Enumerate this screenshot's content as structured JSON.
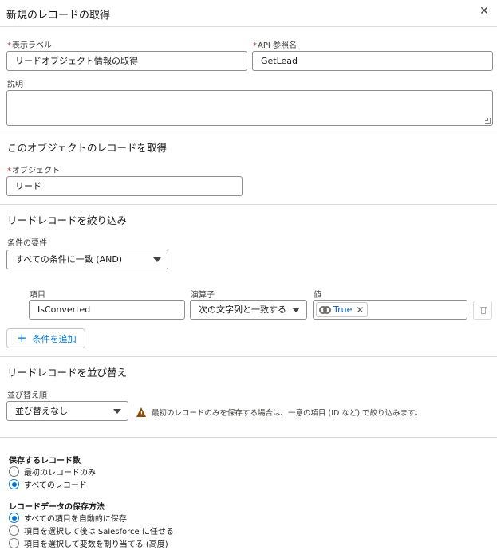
{
  "header": {
    "title": "新規のレコードの取得",
    "close_icon": "close-icon"
  },
  "basic": {
    "label_field": {
      "label": "表示ラベル",
      "value": "リードオブジェクト情報の取得"
    },
    "api_field": {
      "label": "API 参照名",
      "value": "GetLead"
    },
    "description": {
      "label": "説明",
      "value": ""
    }
  },
  "object_section": {
    "title": "このオブジェクトのレコードを取得",
    "object_field": {
      "label": "オブジェクト",
      "value": "リード"
    }
  },
  "filter_section": {
    "title": "リードレコードを絞り込み",
    "requirement_label": "条件の要件",
    "requirement_value": "すべての条件に一致 (AND)",
    "condition": {
      "field_label": "項目",
      "field_value": "IsConverted",
      "operator_label": "演算子",
      "operator_value": "次の文字列と一致する",
      "value_label": "値",
      "value_pill": "True",
      "value_pill_icon": "toggle-icon",
      "delete_icon": "trash-icon"
    },
    "add_condition_label": "条件を追加",
    "add_icon": "plus-icon"
  },
  "sort_section": {
    "title": "リードレコードを並び替え",
    "sort_label": "並び替え順",
    "sort_value": "並び替えなし",
    "warning_icon": "warning-icon",
    "warning_text": "最初のレコードのみを保存する場合は、一意の項目 (ID など) で絞り込みます。"
  },
  "store": {
    "count_title": "保存するレコード数",
    "count_options": [
      {
        "label": "最初のレコードのみ",
        "selected": false
      },
      {
        "label": "すべてのレコード",
        "selected": true
      }
    ],
    "method_title": "レコードデータの保存方法",
    "method_options": [
      {
        "label": "すべての項目を自動的に保存",
        "selected": true
      },
      {
        "label": "項目を選択して後は Salesforce に任せる",
        "selected": false
      },
      {
        "label": "項目を選択して変数を割り当てる (高度)",
        "selected": false
      }
    ]
  },
  "colors": {
    "brand": "#0176d3",
    "required": "#c23934",
    "warning": "#8c4b02",
    "border": "#dddbda"
  }
}
